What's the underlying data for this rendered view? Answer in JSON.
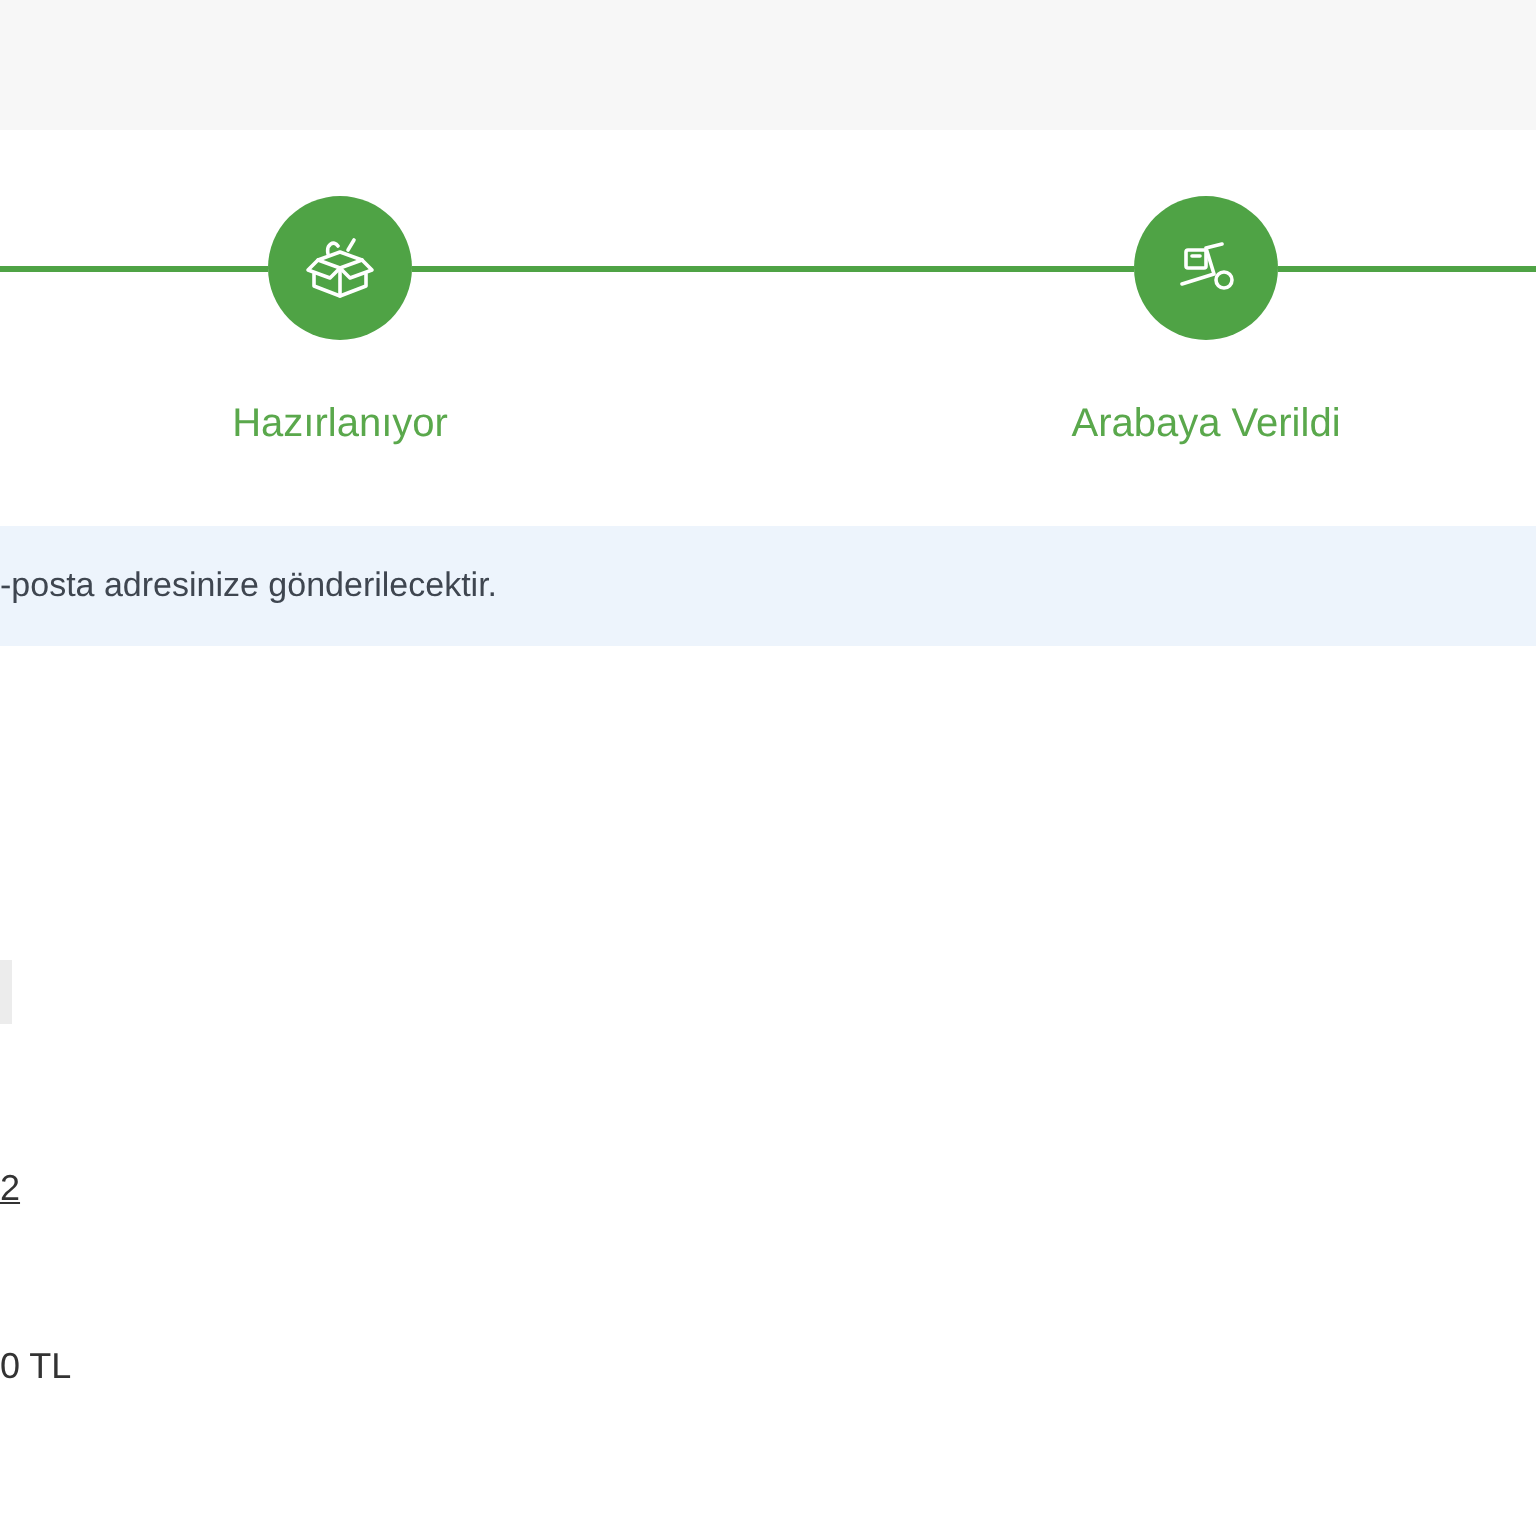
{
  "steps": [
    {
      "label": "Hazırlanıyor",
      "done": true
    },
    {
      "label": "Arabaya Verildi",
      "done": true
    }
  ],
  "notice": {
    "text": "-posta adresinize gönderilecektir."
  },
  "details": {
    "link": "2",
    "amount": "0 TL"
  }
}
